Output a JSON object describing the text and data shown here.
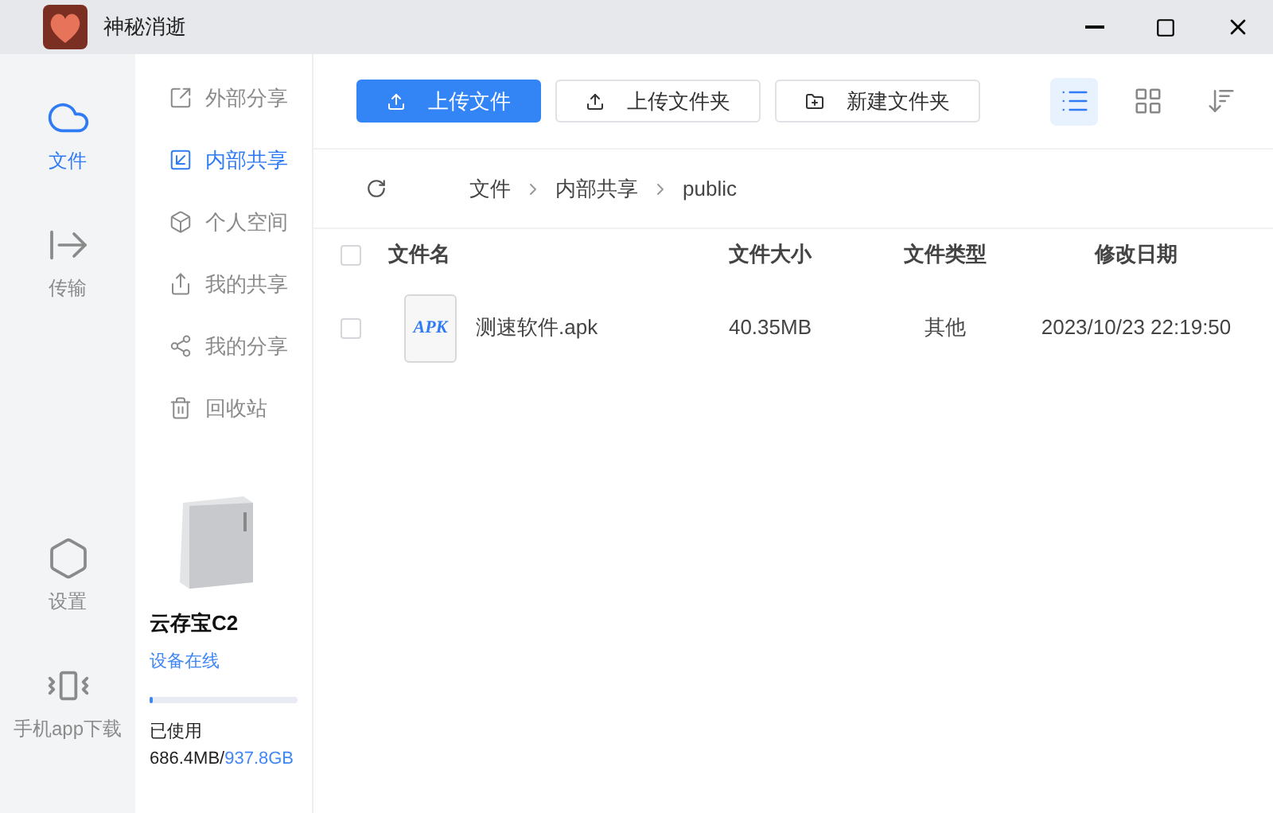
{
  "window": {
    "title": "神秘消逝"
  },
  "rail": {
    "top": [
      {
        "label": "文件",
        "kind": "cloud",
        "selected": true
      },
      {
        "label": "传输",
        "kind": "transfer",
        "selected": false
      }
    ],
    "bottom": [
      {
        "label": "设置",
        "kind": "settings",
        "selected": false
      },
      {
        "label": "手机app下载",
        "kind": "phone",
        "selected": false
      }
    ]
  },
  "subnav": [
    {
      "label": "外部分享",
      "kind": "external",
      "selected": false
    },
    {
      "label": "内部共享",
      "kind": "internal",
      "selected": true
    },
    {
      "label": "个人空间",
      "kind": "cube",
      "selected": false
    },
    {
      "label": "我的共享",
      "kind": "upload",
      "selected": false
    },
    {
      "label": "我的分享",
      "kind": "share",
      "selected": false
    },
    {
      "label": "回收站",
      "kind": "trash",
      "selected": false
    }
  ],
  "device": {
    "name": "云存宝C2",
    "status": "设备在线",
    "level": 0.007,
    "used_label": "已使用",
    "used": "686.4MB/",
    "total": "937.8GB"
  },
  "toolbar": {
    "buttons": [
      {
        "label": "上传文件",
        "kind": "upload",
        "primary": true
      },
      {
        "label": "上传文件夹",
        "kind": "upload",
        "primary": false
      },
      {
        "label": "新建文件夹",
        "kind": "folder",
        "primary": false
      }
    ],
    "views": [
      {
        "kind": "list",
        "selected": true
      },
      {
        "kind": "grid",
        "selected": false
      },
      {
        "kind": "sort",
        "selected": false
      }
    ]
  },
  "breadcrumb": [
    "文件",
    "内部共享",
    "public"
  ],
  "table": {
    "columns": [
      "文件名",
      "文件大小",
      "文件类型",
      "修改日期"
    ],
    "header_checked": false,
    "rows": [
      {
        "name": "测速软件.apk",
        "icon_text": "APK",
        "size": "40.35MB",
        "type": "其他",
        "date": "2023/10/23 22:19:50",
        "checked": false
      }
    ]
  }
}
